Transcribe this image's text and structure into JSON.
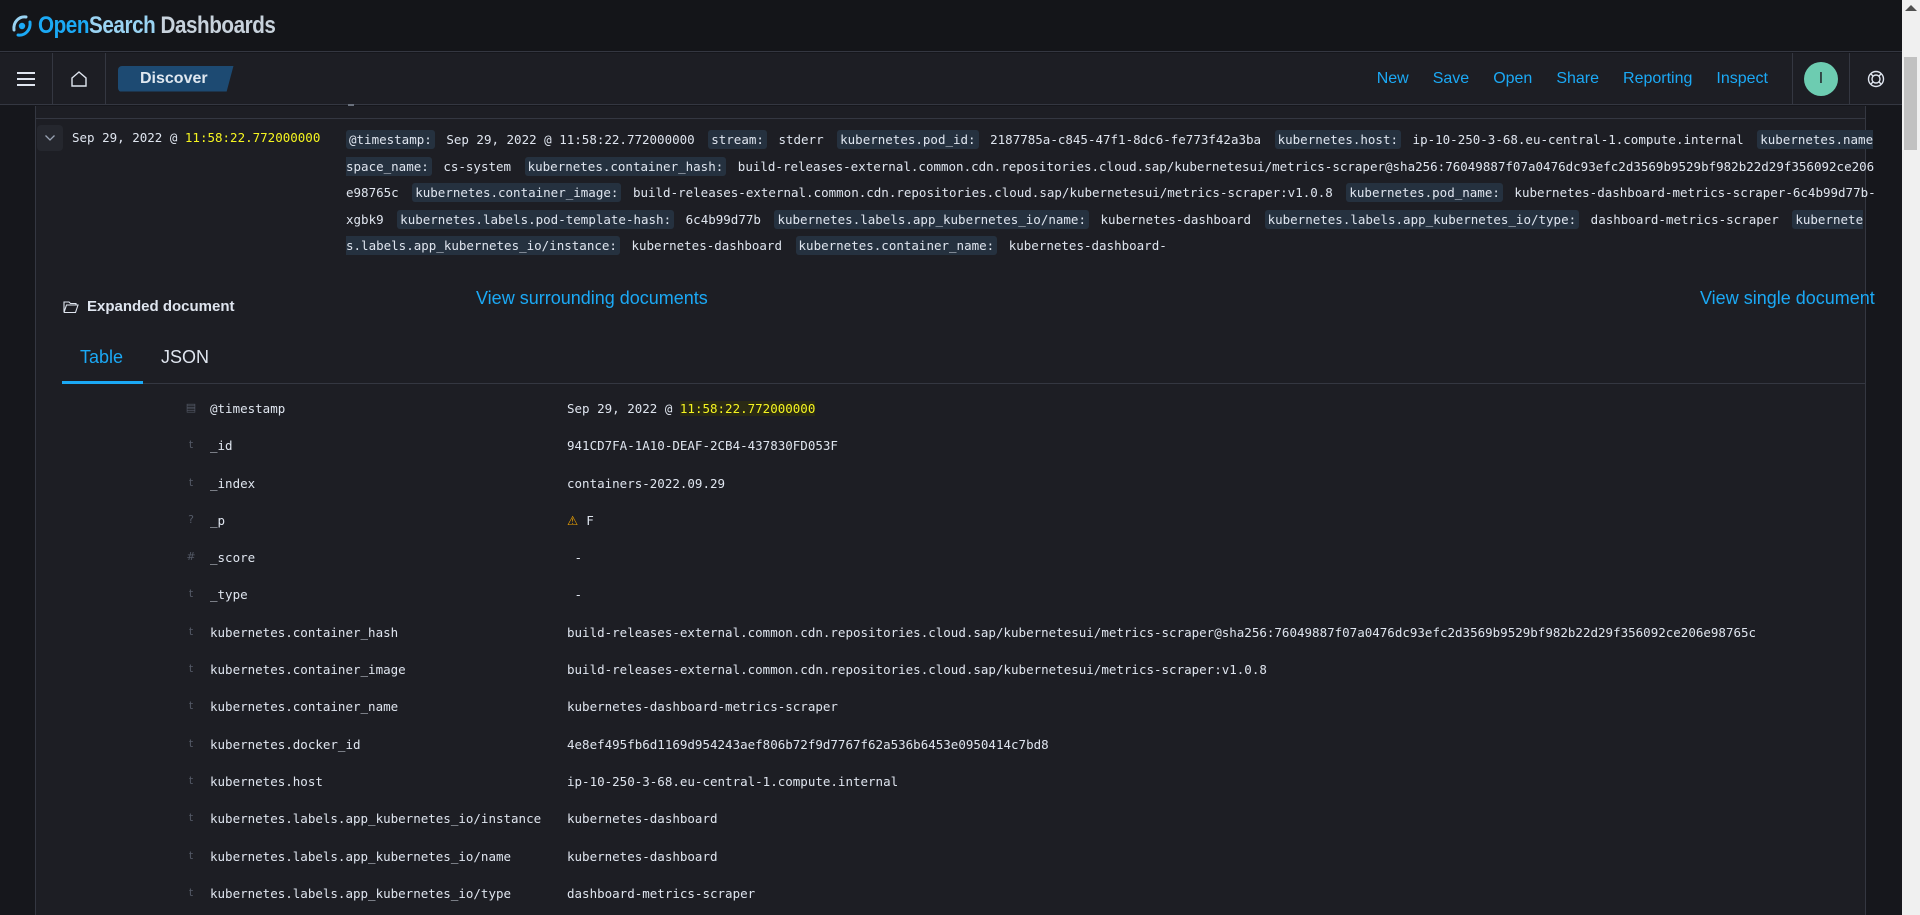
{
  "app": {
    "logo_open": "Open",
    "logo_search": "Search",
    "logo_dashboards": "Dashboards"
  },
  "nav": {
    "breadcrumb": "Discover",
    "menu": [
      "New",
      "Save",
      "Open",
      "Share",
      "Reporting",
      "Inspect"
    ],
    "avatar_initial": "I"
  },
  "row": {
    "time_date": "Sep 29, 2022 @ ",
    "time_clock": "11:58:22.772000000",
    "summary": [
      {
        "k": "@timestamp:",
        "v": "Sep 29, 2022 @ 11:58:22.772000000"
      },
      {
        "k": "stream:",
        "v": "stderr"
      },
      {
        "k": "kubernetes.pod_id:",
        "v": "2187785a-c845-47f1-8dc6-fe773f42a3ba"
      },
      {
        "k": "kubernetes.host:",
        "v": "ip-10-250-3-68.eu-central-1.compute.internal"
      },
      {
        "k": "kubernetes.namespace_name:",
        "v": "cs-system"
      },
      {
        "k": "kubernetes.container_hash:",
        "v": "build-releases-external.common.cdn.repositories.cloud.sap/kubernetesui/metrics-scraper@sha256:76049887f07a0476dc93efc2d3569b9529bf982b22d29f356092ce206e98765c"
      },
      {
        "k": "kubernetes.container_image:",
        "v": "build-releases-external.common.cdn.repositories.cloud.sap/kubernetesui/metrics-scraper:v1.0.8"
      },
      {
        "k": "kubernetes.pod_name:",
        "v": "kubernetes-dashboard-metrics-scraper-6c4b99d77b-xgbk9"
      },
      {
        "k": "kubernetes.labels.pod-template-hash:",
        "v": "6c4b99d77b"
      },
      {
        "k": "kubernetes.labels.app_kubernetes_io/name:",
        "v": "kubernetes-dashboard"
      },
      {
        "k": "kubernetes.labels.app_kubernetes_io/type:",
        "v": "dashboard-metrics-scraper"
      },
      {
        "k": "kubernetes.labels.app_kubernetes_io/instance:",
        "v": "kubernetes-dashboard"
      },
      {
        "k": "kubernetes.container_name:",
        "v": "kubernetes-dashboard-"
      }
    ]
  },
  "expanded": {
    "title": "Expanded document",
    "view_surrounding": "View surrounding documents",
    "view_single": "View single document",
    "tabs": [
      "Table",
      "JSON"
    ],
    "active_tab": "Table"
  },
  "fields": [
    {
      "type": "date",
      "icon": "▤",
      "name": "@timestamp",
      "value_prefix": "Sep 29, 2022 @ ",
      "value_highlight": "11:58:22.772000000"
    },
    {
      "type": "string",
      "icon": "t",
      "name": "_id",
      "value": "941CD7FA-1A10-DEAF-2CB4-437830FD053F"
    },
    {
      "type": "string",
      "icon": "t",
      "name": "_index",
      "value": "containers-2022.09.29"
    },
    {
      "type": "unknown",
      "icon": "?",
      "name": "_p",
      "warning": "⚠",
      "value": "F"
    },
    {
      "type": "number",
      "icon": "#",
      "name": "_score",
      "value": " -"
    },
    {
      "type": "string",
      "icon": "t",
      "name": "_type",
      "value": " -"
    },
    {
      "type": "string",
      "icon": "t",
      "name": "kubernetes.container_hash",
      "value": "build-releases-external.common.cdn.repositories.cloud.sap/kubernetesui/metrics-scraper@sha256:76049887f07a0476dc93efc2d3569b9529bf982b22d29f356092ce206e98765c"
    },
    {
      "type": "string",
      "icon": "t",
      "name": "kubernetes.container_image",
      "value": "build-releases-external.common.cdn.repositories.cloud.sap/kubernetesui/metrics-scraper:v1.0.8"
    },
    {
      "type": "string",
      "icon": "t",
      "name": "kubernetes.container_name",
      "value": "kubernetes-dashboard-metrics-scraper"
    },
    {
      "type": "string",
      "icon": "t",
      "name": "kubernetes.docker_id",
      "value": "4e8ef495fb6d1169d954243aef806b72f9d7767f62a536b6453e0950414c7bd8"
    },
    {
      "type": "string",
      "icon": "t",
      "name": "kubernetes.host",
      "value": "ip-10-250-3-68.eu-central-1.compute.internal"
    },
    {
      "type": "string",
      "icon": "t",
      "name": "kubernetes.labels.app_kubernetes_io/instance",
      "value": "kubernetes-dashboard"
    },
    {
      "type": "string",
      "icon": "t",
      "name": "kubernetes.labels.app_kubernetes_io/name",
      "value": "kubernetes-dashboard"
    },
    {
      "type": "string",
      "icon": "t",
      "name": "kubernetes.labels.app_kubernetes_io/type",
      "value": "dashboard-metrics-scraper"
    }
  ],
  "colors": {
    "accent": "#1ba9f5",
    "highlight": "#f5f520",
    "background": "#1d1e24",
    "avatar": "#6dccb1"
  }
}
